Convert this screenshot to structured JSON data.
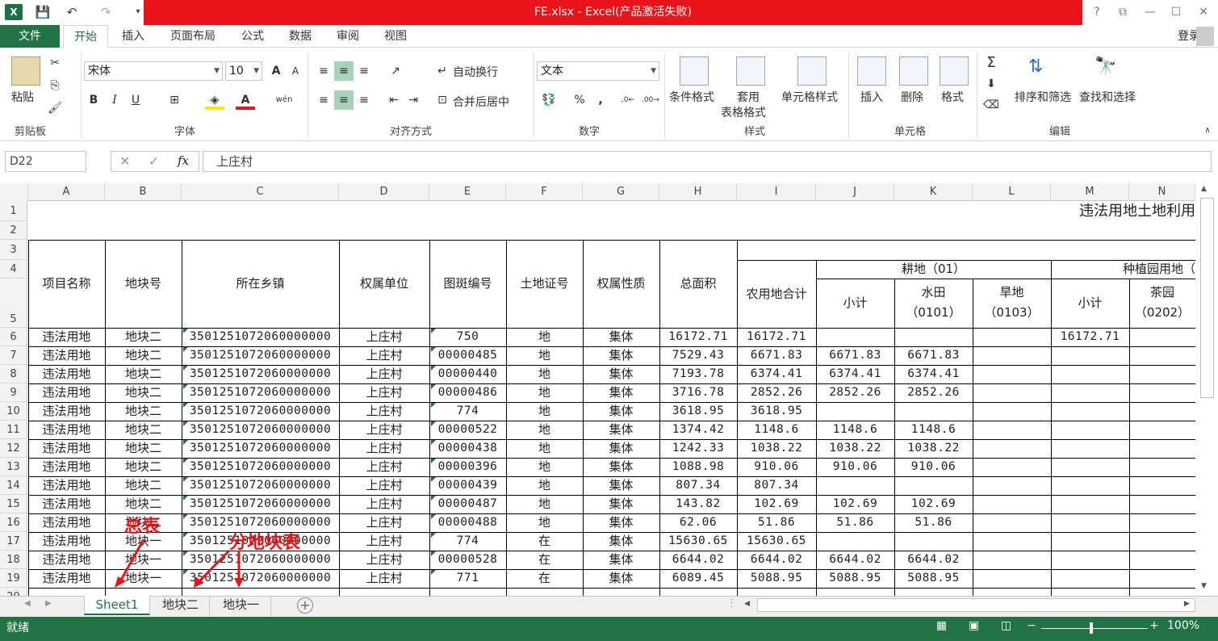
{
  "window": {
    "title": "FE.xlsx -  Excel(产品激活失败)",
    "login": "登录"
  },
  "quick_access": {
    "logo_text": "X"
  },
  "menu": {
    "file": "文件",
    "tabs": [
      "开始",
      "插入",
      "页面布局",
      "公式",
      "数据",
      "审阅",
      "视图"
    ]
  },
  "ribbon": {
    "clipboard": {
      "paste": "粘贴",
      "label": "剪贴板"
    },
    "font": {
      "name": "宋体",
      "size": "10",
      "bold": "B",
      "italic": "I",
      "underline": "U",
      "label": "字体",
      "grow": "A",
      "shrink": "A",
      "wen": "wén"
    },
    "alignment": {
      "wrap": "自动换行",
      "merge": "合并后居中",
      "label": "对齐方式"
    },
    "number": {
      "format": "文本",
      "percent": "%",
      "comma": ",",
      "label": "数字"
    },
    "styles": {
      "conditional": "条件格式",
      "table_line1": "套用",
      "table_line2": "表格格式",
      "cell_styles": "单元格样式",
      "label": "样式"
    },
    "cells": {
      "insert": "插入",
      "delete": "删除",
      "format": "格式",
      "label": "单元格"
    },
    "editing": {
      "sort": "排序和筛选",
      "find": "查找和选择",
      "label": "编辑"
    }
  },
  "formula_bar": {
    "name_box": "D22",
    "content": "上庄村",
    "fx": "fx"
  },
  "columns": [
    "A",
    "B",
    "C",
    "D",
    "E",
    "F",
    "G",
    "H",
    "I",
    "J",
    "K",
    "L",
    "M",
    "N"
  ],
  "rows": [
    "1",
    "2",
    "3",
    "4",
    "5",
    "6",
    "7",
    "8",
    "9",
    "10",
    "11",
    "12",
    "13",
    "14",
    "15",
    "16",
    "17",
    "18",
    "19",
    "20"
  ],
  "sheet": {
    "title": "违法用地土地利用",
    "headers": {
      "project": "项目名称",
      "plot": "地块号",
      "town": "所在乡镇",
      "owner": "权属单位",
      "map_no": "图斑编号",
      "cert": "土地证号",
      "nature": "权属性质",
      "total": "总面积",
      "agri_total": "农用地合计",
      "arable": "耕地（01）",
      "subtotal": "小计",
      "paddy_1": "水田",
      "paddy_2": "（0101）",
      "dry_1": "旱地",
      "dry_2": "（0103）",
      "garden": "种植园用地（",
      "subtotal2": "小计",
      "tea_1": "茶园",
      "tea_2": "（0202）"
    },
    "data": [
      [
        "违法用地",
        "地块二",
        "3501251072060000000",
        "上庄村",
        "750",
        "地",
        "集体",
        "16172.71",
        "16172.71",
        "",
        "",
        "",
        "16172.71"
      ],
      [
        "违法用地",
        "地块二",
        "3501251072060000000",
        "上庄村",
        "00000485",
        "地",
        "集体",
        "7529.43",
        "6671.83",
        "6671.83",
        "6671.83",
        "",
        ""
      ],
      [
        "违法用地",
        "地块二",
        "3501251072060000000",
        "上庄村",
        "00000440",
        "地",
        "集体",
        "7193.78",
        "6374.41",
        "6374.41",
        "6374.41",
        "",
        ""
      ],
      [
        "违法用地",
        "地块二",
        "3501251072060000000",
        "上庄村",
        "00000486",
        "地",
        "集体",
        "3716.78",
        "2852.26",
        "2852.26",
        "2852.26",
        "",
        ""
      ],
      [
        "违法用地",
        "地块二",
        "3501251072060000000",
        "上庄村",
        "774",
        "地",
        "集体",
        "3618.95",
        "3618.95",
        "",
        "",
        "",
        ""
      ],
      [
        "违法用地",
        "地块二",
        "3501251072060000000",
        "上庄村",
        "00000522",
        "地",
        "集体",
        "1374.42",
        "1148.6",
        "1148.6",
        "1148.6",
        "",
        ""
      ],
      [
        "违法用地",
        "地块二",
        "3501251072060000000",
        "上庄村",
        "00000438",
        "地",
        "集体",
        "1242.33",
        "1038.22",
        "1038.22",
        "1038.22",
        "",
        ""
      ],
      [
        "违法用地",
        "地块二",
        "3501251072060000000",
        "上庄村",
        "00000396",
        "地",
        "集体",
        "1088.98",
        "910.06",
        "910.06",
        "910.06",
        "",
        ""
      ],
      [
        "违法用地",
        "地块二",
        "3501251072060000000",
        "上庄村",
        "00000439",
        "地",
        "集体",
        "807.34",
        "807.34",
        "",
        "",
        "",
        ""
      ],
      [
        "违法用地",
        "地块二",
        "3501251072060000000",
        "上庄村",
        "00000487",
        "地",
        "集体",
        "143.82",
        "102.69",
        "102.69",
        "102.69",
        "",
        ""
      ],
      [
        "违法用地",
        "地块二",
        "3501251072060000000",
        "上庄村",
        "00000488",
        "地",
        "集体",
        "62.06",
        "51.86",
        "51.86",
        "51.86",
        "",
        ""
      ],
      [
        "违法用地",
        "地块一",
        "3501251072060000000",
        "上庄村",
        "774",
        "在",
        "集体",
        "15630.65",
        "15630.65",
        "",
        "",
        "",
        ""
      ],
      [
        "违法用地",
        "地块一",
        "3501251072060000000",
        "上庄村",
        "00000528",
        "在",
        "集体",
        "6644.02",
        "6644.02",
        "6644.02",
        "6644.02",
        "",
        ""
      ],
      [
        "违法用地",
        "地块一",
        "3501251072060000000",
        "上庄村",
        "771",
        "在",
        "集体",
        "6089.45",
        "5088.95",
        "5088.95",
        "5088.95",
        "",
        ""
      ]
    ]
  },
  "sheet_tabs": [
    "Sheet1",
    "地块二",
    "地块一"
  ],
  "status": {
    "ready": "就绪",
    "zoom": "100%"
  },
  "annotations": {
    "total_sheet": "总表",
    "plot_sheets": "分地块表"
  }
}
